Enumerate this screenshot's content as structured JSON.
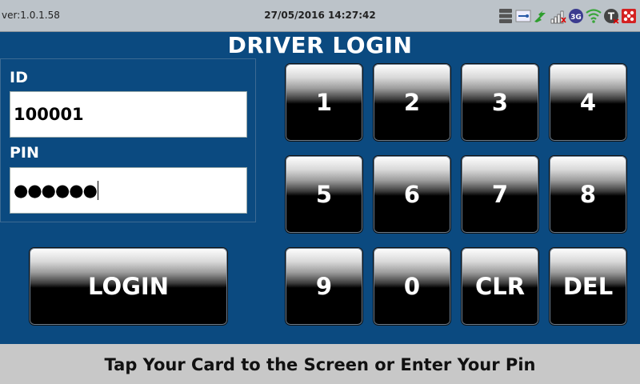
{
  "status_bar": {
    "version": "ver:1.0.1.58",
    "datetime": "27/05/2016 14:27:42",
    "icons": [
      "storage-icon",
      "keycard-icon",
      "link-icon",
      "signal-icon",
      "3g-icon",
      "wifi-icon",
      "tacho-icon",
      "alert-icon"
    ],
    "network_label": "3G",
    "tacho_label": "T"
  },
  "title": "DRIVER LOGIN",
  "form": {
    "id_label": "ID",
    "id_value": "100001",
    "pin_label": "PIN",
    "pin_value": "●●●●●●"
  },
  "login_label": "LOGIN",
  "keypad": {
    "k1": "1",
    "k2": "2",
    "k3": "3",
    "k4": "4",
    "k5": "5",
    "k6": "6",
    "k7": "7",
    "k8": "8",
    "k9": "9",
    "k0": "0",
    "clr": "CLR",
    "del": "DEL"
  },
  "prompt": "Tap Your Card to the Screen or Enter Your Pin",
  "colors": {
    "background": "#0b4a80",
    "status_bar": "#bcc3c9",
    "bottom_bar": "#c8c8c8",
    "button": "#000000"
  }
}
